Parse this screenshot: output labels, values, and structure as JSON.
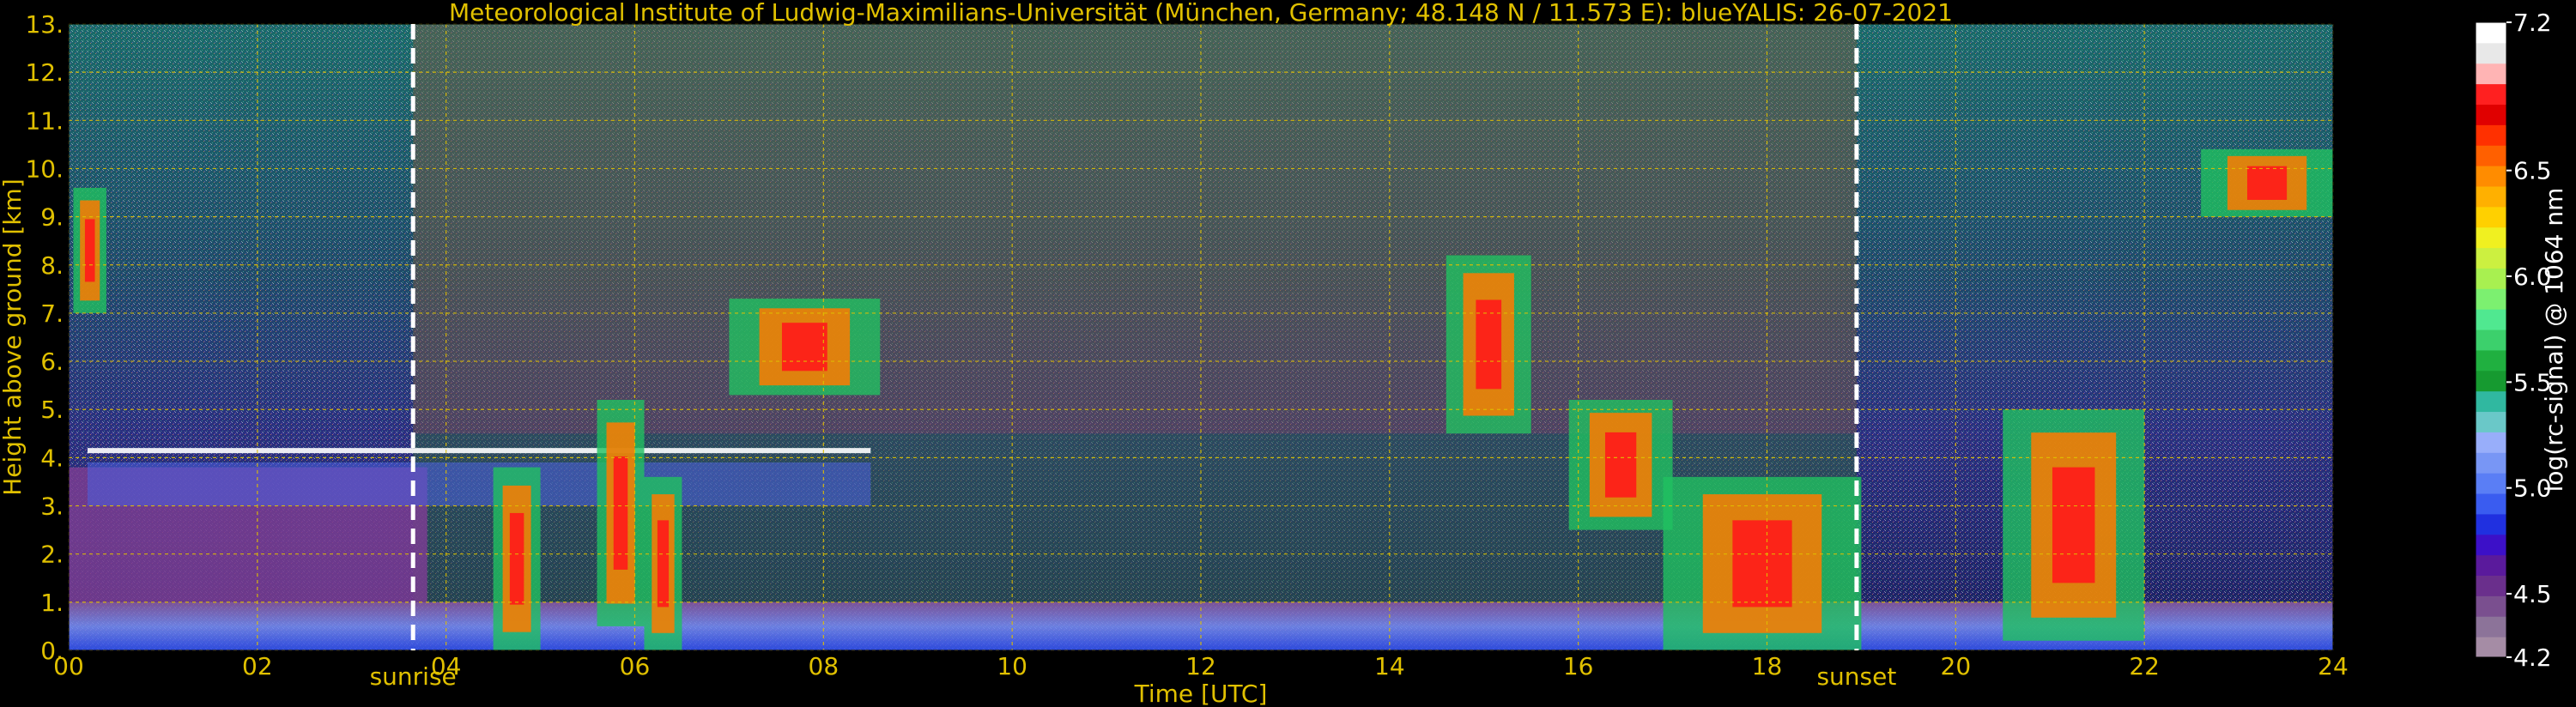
{
  "chart_data": {
    "type": "heatmap",
    "title": "Meteorological Institute of Ludwig-Maximilians-Universität (München, Germany; 48.148 N / 11.573 E):     blueYALIS: 26-07-2021",
    "xlabel": "Time [UTC]",
    "ylabel": "Height above ground [km]",
    "xlim": [
      0,
      24
    ],
    "ylim": [
      0,
      13
    ],
    "xticks": [
      "00",
      "02",
      "04",
      "06",
      "08",
      "10",
      "12",
      "14",
      "16",
      "18",
      "20",
      "22",
      "24"
    ],
    "yticks": [
      "0.",
      "1.",
      "2.",
      "3.",
      "4.",
      "5.",
      "6.",
      "7.",
      "8.",
      "9.",
      "10.",
      "11.",
      "12.",
      "13."
    ],
    "grid": true,
    "colorbar": {
      "label": "log(rc-signal) @ 1064 nm",
      "range": [
        4.2,
        7.2
      ],
      "ticks": [
        "4.2",
        "4.5",
        "5.0",
        "5.5",
        "6.0",
        "6.5",
        "7.2"
      ],
      "colors": [
        "#a58ca5",
        "#8c7399",
        "#7a4f8f",
        "#6a2f8c",
        "#5a1a9c",
        "#3c10c8",
        "#2030e0",
        "#3a5cf0",
        "#5a7ef5",
        "#7896f5",
        "#98aefa",
        "#6ac8c8",
        "#30b8a0",
        "#169a30",
        "#20b040",
        "#3cd06c",
        "#50e890",
        "#7cf070",
        "#a8f050",
        "#ccf040",
        "#f0f020",
        "#ffd000",
        "#ffb000",
        "#ff8c00",
        "#ff6000",
        "#ff3000",
        "#e00000",
        "#ff2020",
        "#ffb4b4",
        "#e8e8e8",
        "#ffffff"
      ]
    },
    "markers": [
      {
        "label": "sunrise",
        "x": 3.65
      },
      {
        "label": "sunset",
        "x": 18.95
      }
    ],
    "features": [
      {
        "name": "boundary-layer",
        "x": [
          0,
          24
        ],
        "y": [
          0,
          1.0
        ]
      },
      {
        "name": "residual-layer",
        "x": [
          0,
          3.8
        ],
        "y": [
          1.0,
          3.8
        ]
      },
      {
        "name": "elevated-layer-top",
        "x": [
          0.2,
          8.5
        ],
        "y": [
          3.0,
          4.6
        ]
      },
      {
        "name": "cloud",
        "x": [
          0.05,
          0.4
        ],
        "y": [
          7.0,
          9.6
        ]
      },
      {
        "name": "cloud",
        "x": [
          4.5,
          5.0
        ],
        "y": [
          0,
          3.8
        ]
      },
      {
        "name": "cloud",
        "x": [
          5.6,
          6.1
        ],
        "y": [
          0.5,
          5.2
        ]
      },
      {
        "name": "cloud",
        "x": [
          6.1,
          6.5
        ],
        "y": [
          0,
          3.6
        ]
      },
      {
        "name": "cloud",
        "x": [
          7.0,
          8.6
        ],
        "y": [
          5.3,
          7.3
        ]
      },
      {
        "name": "cloud",
        "x": [
          14.6,
          15.5
        ],
        "y": [
          4.5,
          8.2
        ]
      },
      {
        "name": "cloud",
        "x": [
          15.9,
          17.0
        ],
        "y": [
          2.5,
          5.2
        ]
      },
      {
        "name": "cloud",
        "x": [
          16.9,
          19.0
        ],
        "y": [
          0,
          3.6
        ]
      },
      {
        "name": "cloud",
        "x": [
          20.5,
          22.0
        ],
        "y": [
          0.2,
          5.0
        ]
      },
      {
        "name": "cloud",
        "x": [
          22.6,
          24.0
        ],
        "y": [
          9.0,
          10.4
        ]
      }
    ]
  }
}
